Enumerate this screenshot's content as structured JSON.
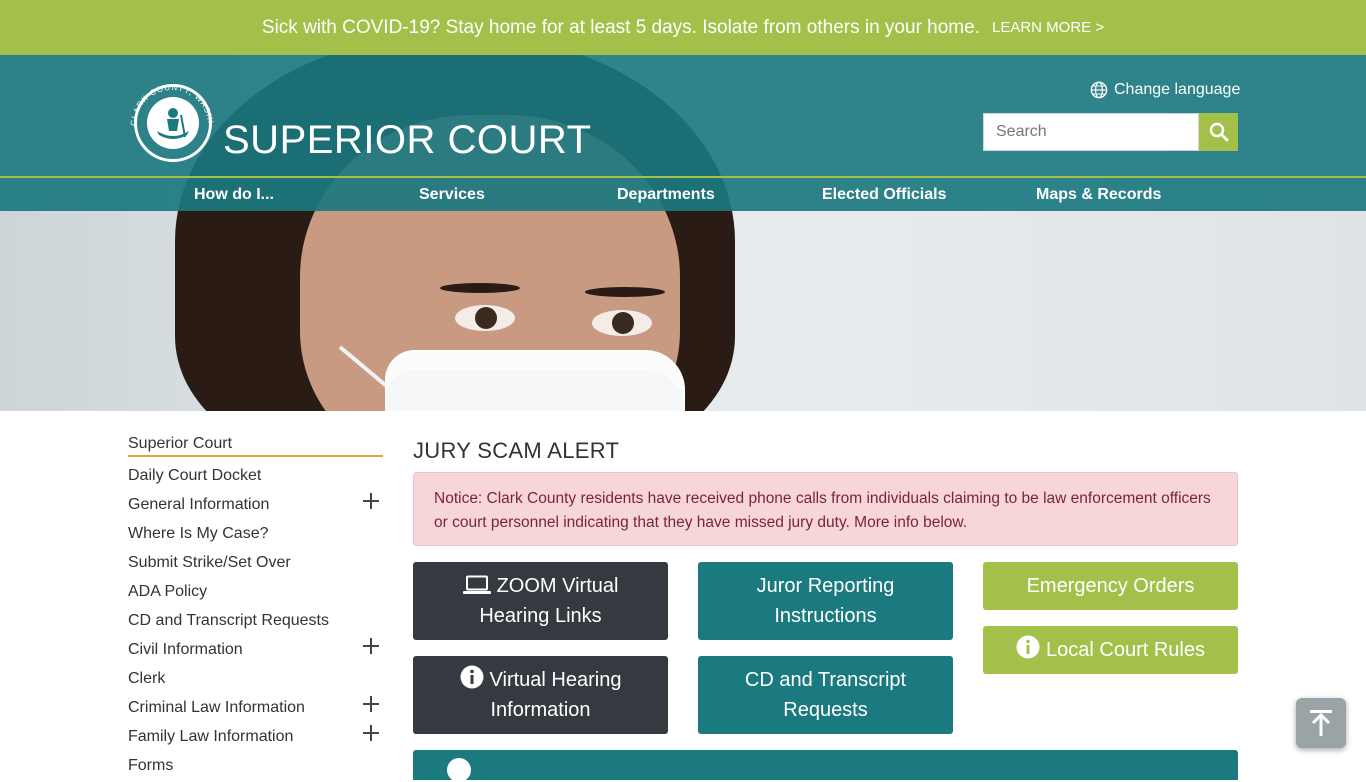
{
  "alert": {
    "message": "Sick with COVID-19? Stay home for at least 5 days. Isolate from others in your home.",
    "link": "LEARN MORE >"
  },
  "header": {
    "logo_text": "CLARK COUNTY, WASHINGTON",
    "site_title": "SUPERIOR COURT",
    "change_language": "Change language",
    "search_placeholder": "Search"
  },
  "nav": {
    "items": [
      "How do I...",
      "Services",
      "Departments",
      "Elected Officials",
      "Maps & Records"
    ]
  },
  "sidebar": {
    "items": [
      {
        "label": "Superior Court",
        "expandable": false
      },
      {
        "label": "Daily Court Docket",
        "expandable": false
      },
      {
        "label": "General Information",
        "expandable": true
      },
      {
        "label": "Where Is My Case?",
        "expandable": false
      },
      {
        "label": "Submit Strike/Set Over",
        "expandable": false
      },
      {
        "label": "ADA Policy",
        "expandable": false
      },
      {
        "label": "CD and Transcript Requests",
        "expandable": false
      },
      {
        "label": "Civil Information",
        "expandable": true
      },
      {
        "label": "Clerk",
        "expandable": false
      },
      {
        "label": "Criminal Law Information",
        "expandable": true
      },
      {
        "label": "Family Law Information",
        "expandable": true
      },
      {
        "label": "Forms",
        "expandable": false
      }
    ]
  },
  "main": {
    "title": "JURY SCAM ALERT",
    "notice": "Notice: Clark County residents have received phone calls from individuals claiming to be law enforcement officers or court personnel indicating that they have missed jury duty. More info below.",
    "buttons": {
      "zoom": "ZOOM Virtual Hearing Links",
      "juror": "Juror Reporting Instructions",
      "emergency": "Emergency Orders",
      "virtual": "Virtual Hearing Information",
      "cd": "CD and Transcript Requests",
      "local_rules": "Local Court Rules"
    }
  },
  "colors": {
    "green": "#a3c04a",
    "teal": "#1b7a7f",
    "dark": "#343a40",
    "notice_bg": "#f7d6da"
  }
}
